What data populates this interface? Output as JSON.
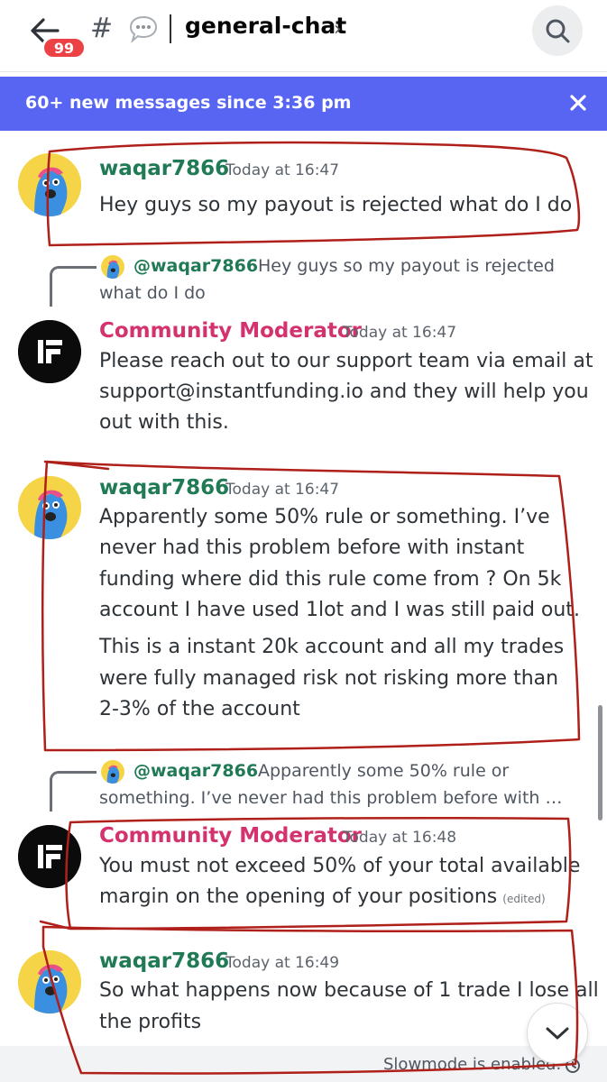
{
  "header": {
    "notification_count": "99",
    "channel_hash": "#",
    "channel_name": "general-chat",
    "channel_chevron": "›",
    "icons": [
      "back-arrow-icon",
      "speech-bubble-icon",
      "search-icon"
    ]
  },
  "banner": {
    "text": "60+ new messages since 3:36 pm",
    "close_icon": "close-icon"
  },
  "messages": [
    {
      "author": "waqar7866",
      "time": "Today at 16:47",
      "text": "Hey guys so my payout is rejected what do I do"
    },
    {
      "reply_to": "@waqar7866",
      "reply_line1": "Hey guys so my payout is rejected",
      "reply_line2": "what do I do",
      "author": "Community Moderator",
      "time": "Today at 16:47",
      "line1": "Please reach out to our support team via email at",
      "line2": "support@instantfunding.io and they will help you",
      "line3": "out with this."
    },
    {
      "author": "waqar7866",
      "time": "Today at 16:47",
      "p1_line1": "Apparently some 50% rule or something. I’ve",
      "p1_line2": "never had this problem before with instant",
      "p1_line3": "funding where did this rule come from ? On 5k",
      "p1_line4": "account I have used 1lot and I was still paid out.",
      "p2_line1": "This is a instant 20k account and all my trades",
      "p2_line2": "were fully managed risk not risking more than",
      "p2_line3": "2-3% of the account"
    },
    {
      "reply_to": "@waqar7866",
      "reply_line1": "Apparently some 50% rule or",
      "reply_line2": "something. I’ve never had this problem before with …",
      "author": "Community Moderator",
      "time": "Today at 16:48",
      "line1": "You must not exceed 50% of your total available",
      "line2": "margin on the opening of your positions",
      "edited": "(edited)"
    },
    {
      "author": "waqar7866",
      "time": "Today at 16:49",
      "line1": "So what happens now because of 1 trade I lose all",
      "line2": "the profits"
    }
  ],
  "footer": {
    "slowmode_text": "Slowmode is enabled.",
    "jump_icon": "chevron-down-icon"
  },
  "colors": {
    "banner": "#5865f2",
    "badge": "#ed4245",
    "user_name": "#1f7a55",
    "mod_name": "#d4326e",
    "annotation": "#b0201a"
  }
}
